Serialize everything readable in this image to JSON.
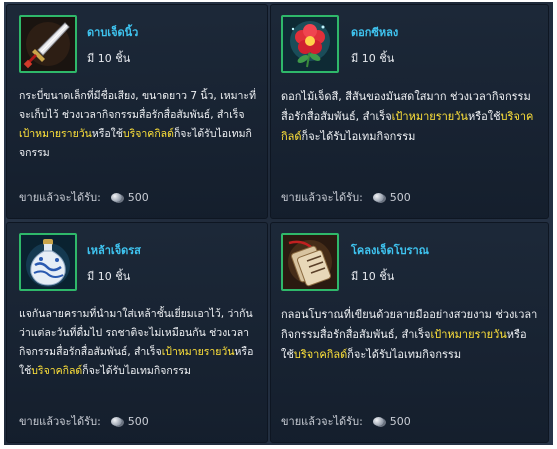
{
  "items": [
    {
      "name": "ดาบเจ็ดนิ้ว",
      "icon": "dagger-icon",
      "qty": "มี 10 ชิ้น",
      "desc_parts": [
        {
          "text": "กระบี่ขนาดเล็กที่มีชื่อเสียง, ขนาดยาว 7 นิ้ว, เหมาะที่จะเก็บไว้ ช่วงเวลากิจกรรมสื่อรักสื่อสัมพันธ์, สำเร็จ",
          "hl": false
        },
        {
          "text": "เป้าหมายรายวัน",
          "hl": true
        },
        {
          "text": "หรือใช้",
          "hl": false
        },
        {
          "text": "บริจาคกิลด์",
          "hl": true
        },
        {
          "text": "ก็จะได้รับไอเทมกิจกรรม",
          "hl": false
        }
      ],
      "sell_label": "ขายแล้วจะได้รับ:",
      "sell_value": "500"
    },
    {
      "name": "ดอกซีหลง",
      "icon": "flower-icon",
      "qty": "มี 10 ชิ้น",
      "desc_parts": [
        {
          "text": "ดอกไม้เจ็ดสี, สีสันของมันสดใสมาก ช่วงเวลากิจกรรมสื่อรักสื่อสัมพันธ์, สำเร็จ",
          "hl": false
        },
        {
          "text": "เป้าหมายรายวัน",
          "hl": true
        },
        {
          "text": "หรือใช้",
          "hl": false
        },
        {
          "text": "บริจาคกิลด์",
          "hl": true
        },
        {
          "text": "ก็จะได้รับไอเทมกิจกรรม",
          "hl": false
        }
      ],
      "sell_label": "ขายแล้วจะได้รับ:",
      "sell_value": "500"
    },
    {
      "name": "เหล้าเจ็ดรส",
      "icon": "wine-jar-icon",
      "qty": "มี 10 ชิ้น",
      "desc_parts": [
        {
          "text": "แจกันลายครามที่นำมาใส่เหล้าชั้นเยี่ยมเอาไว้, ว่ากันว่าแต่ละวันที่ดื่มไป รถชาติจะไม่เหมือนกัน ช่วงเวลากิจกรรมสื่อรักสื่อสัมพันธ์, สำเร็จ",
          "hl": false
        },
        {
          "text": "เป้าหมายรายวัน",
          "hl": true
        },
        {
          "text": "หรือใช้",
          "hl": false
        },
        {
          "text": "บริจาคกิลด์",
          "hl": true
        },
        {
          "text": "ก็จะได้รับไอเทมกิจกรรม",
          "hl": false
        }
      ],
      "sell_label": "ขายแล้วจะได้รับ:",
      "sell_value": "500"
    },
    {
      "name": "โคลงเจ็ดโบราณ",
      "icon": "ancient-poem-tag-icon",
      "qty": "มี 10 ชิ้น",
      "desc_parts": [
        {
          "text": "กลอนโบราณที่เขียนด้วยลายมืออย่างสวยงาม ช่วงเวลากิจกรรมสื่อรักสื่อสัมพันธ์, สำเร็จ",
          "hl": false
        },
        {
          "text": "เป้าหมายรายวัน",
          "hl": true
        },
        {
          "text": "หรือใช้",
          "hl": false
        },
        {
          "text": "บริจาคกิลด์",
          "hl": true
        },
        {
          "text": "ก็จะได้รับไอเทมกิจกรรม",
          "hl": false
        }
      ],
      "sell_label": "ขายแล้วจะได้รับ:",
      "sell_value": "500"
    }
  ],
  "colors": {
    "name": "#3fc4f0",
    "highlight": "#ffe23a",
    "frame": "#2fb86a"
  }
}
